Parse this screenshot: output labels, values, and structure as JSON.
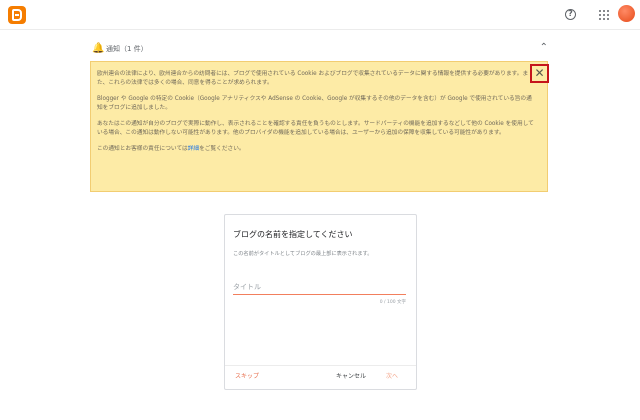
{
  "header": {
    "logo_icon": "blogger-logo",
    "help_icon": "help-icon",
    "apps_icon": "apps-grid-icon",
    "avatar_icon": "account-avatar"
  },
  "notice": {
    "title": "通知（1 件）",
    "paragraph_1": "欧州連合の法律により、欧州連合からの訪問者には、ブログで使用されている Cookie およびブログで収集されているデータに関する情報を提供する必要があります。また、これらの法律では多くの場合、同意を得ることが求められます。",
    "paragraph_2": "Blogger や Google の特定の Cookie（Google アナリティクスや AdSense の Cookie、Google が収集するその他のデータを含む）が Google で使用されている旨の通知をブログに追加しました。",
    "paragraph_3": "あなたはこの通知が自分のブログで実際に動作し、表示されることを確認する責任を負うものとします。サードパーティの機能を追加するなどして他の Cookie を使用している場合、この通知は動作しない可能性があります。他のプロバイダの機能を追加している場合は、ユーザーから追加の保障を収集している可能性があります。",
    "paragraph_4_prefix": "この通知とお客様の責任については",
    "paragraph_4_link": "詳細",
    "paragraph_4_suffix": "をご覧ください。",
    "close_symbol": "✕",
    "collapse_symbol": "⌃"
  },
  "dialog": {
    "title": "ブログの名前を指定してください",
    "subtitle": "この名前がタイトルとしてブログの最上部に表示されます。",
    "input_placeholder": "タイトル",
    "input_value": "",
    "counter": "0 / 100 文字",
    "skip_label": "スキップ",
    "cancel_label": "キャンセル",
    "next_label": "次へ"
  }
}
